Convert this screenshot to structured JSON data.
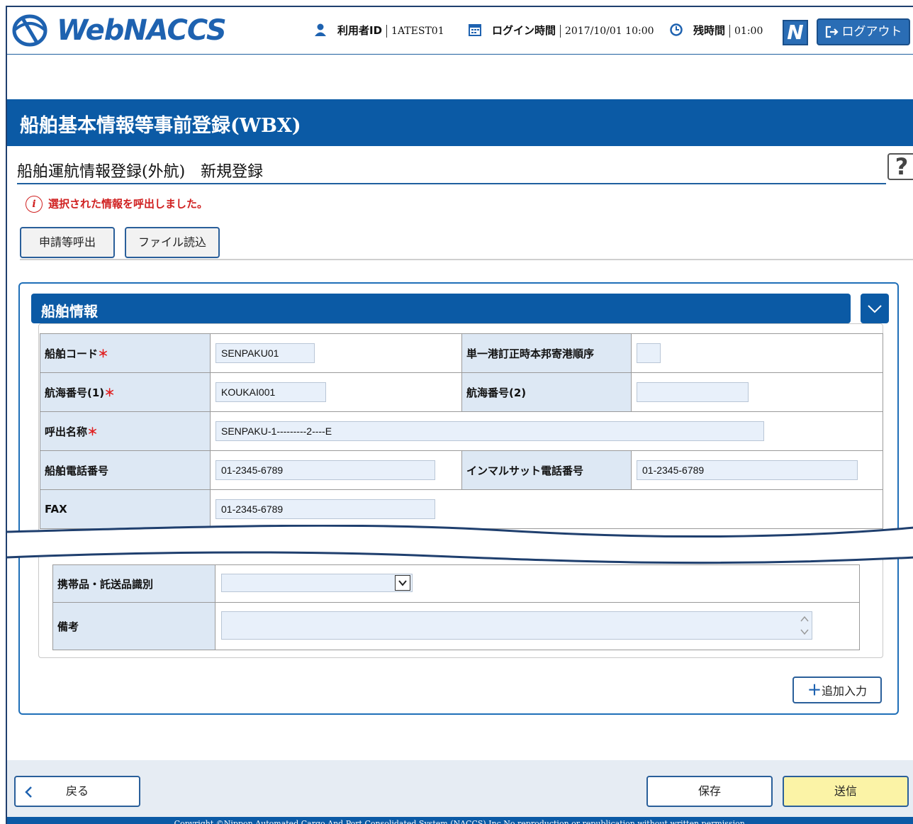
{
  "header": {
    "logo_text": "WebNACCS",
    "user_id_label": "利用者ID",
    "user_id_value": "1ATEST01",
    "login_time_label": "ログイン時間",
    "login_time_value": "2017/10/01 10:00",
    "remaining_label": "残時間",
    "remaining_value": "01:00",
    "n_label": "N",
    "logout_label": "ログアウト"
  },
  "page": {
    "title": "船舶基本情報等事前登録(WBX)",
    "subtitle": "船舶運航情報登録(外航)　新規登録",
    "help_label": "?",
    "message": "選択された情報を呼出しました。",
    "message_icon": "i"
  },
  "toolbar": {
    "call_label": "申請等呼出",
    "file_label": "ファイル読込"
  },
  "section": {
    "title": "船舶情報",
    "fields": {
      "ship_code_label": "船舶コード",
      "ship_code_value": "SENPAKU01",
      "port_order_label": "単一港訂正時本邦寄港順序",
      "port_order_value": "",
      "voyage1_label": "航海番号(1)",
      "voyage1_value": "KOUKAI001",
      "voyage2_label": "航海番号(2)",
      "voyage2_value": "",
      "call_sign_label": "呼出名称",
      "call_sign_value": "SENPAKU-1---------2----E",
      "ship_tel_label": "船舶電話番号",
      "ship_tel_value": "01-2345-6789",
      "inmarsat_label": "インマルサット電話番号",
      "inmarsat_value": "01-2345-6789",
      "fax_label": "FAX",
      "fax_value": "01-2345-6789",
      "carry_label": "携帯品・託送品識別",
      "carry_value": "",
      "remarks_label": "備考",
      "remarks_value": ""
    },
    "required_mark": "＊",
    "add_label": "追加入力"
  },
  "footer": {
    "back_label": "戻る",
    "save_label": "保存",
    "send_label": "送信",
    "copyright": "Copyright ©Nippon Automated Cargo And Port Consolidated System (NACCS) Inc.No reproduction or republication without written permission."
  },
  "colors": {
    "brand": "#0b5aa5",
    "required": "#e02020",
    "send_button": "#fbf3a6"
  }
}
